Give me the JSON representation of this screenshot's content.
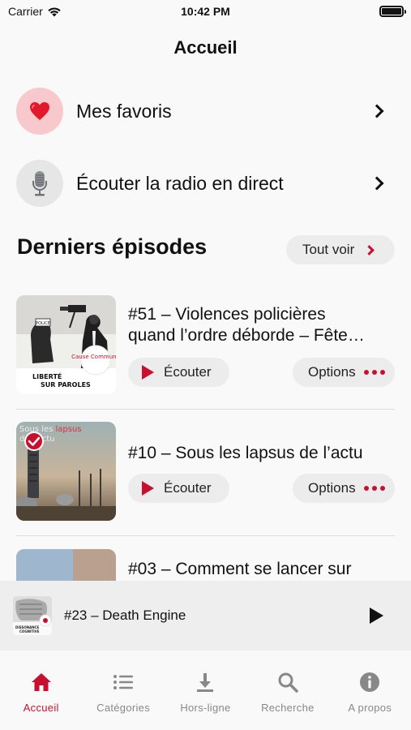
{
  "status_bar": {
    "carrier": "Carrier",
    "time": "10:42 PM"
  },
  "header": {
    "title": "Accueil"
  },
  "menu": [
    {
      "label": "Mes favoris",
      "icon": "heart-icon"
    },
    {
      "label": "Écouter la radio en direct",
      "icon": "microphone-icon"
    }
  ],
  "latest": {
    "title": "Derniers épisodes",
    "see_all": "Tout voir"
  },
  "episodes": [
    {
      "title": "#51 – Violences policières",
      "title_line2": "quand l’ordre déborde – Fête…",
      "listen": "Écouter",
      "options": "Options",
      "thumb_caption": "LIBERTÉ SUR PAROLES",
      "thumb_stamp": "Cause Commune",
      "thumb_sign": "POLICE"
    },
    {
      "title": "#10 – Sous les lapsus de l’actu",
      "listen": "Écouter",
      "options": "Options",
      "thumb_caption": "Sous les lapsus de l’actu",
      "downloaded": true
    },
    {
      "title": "#03 – Comment se lancer sur"
    }
  ],
  "mini_player": {
    "title": "#23 – Death Engine",
    "thumb_caption": "DISSONANCE COGNITIVE"
  },
  "tabs": [
    {
      "label": "Accueil",
      "icon": "home-icon",
      "active": true
    },
    {
      "label": "Catégories",
      "icon": "list-icon",
      "active": false
    },
    {
      "label": "Hors-ligne",
      "icon": "download-icon",
      "active": false
    },
    {
      "label": "Recherche",
      "icon": "search-icon",
      "active": false
    },
    {
      "label": "A propos",
      "icon": "info-icon",
      "active": false
    }
  ],
  "colors": {
    "accent": "#c8102e",
    "inactive": "#888888",
    "pill": "#ececec"
  }
}
